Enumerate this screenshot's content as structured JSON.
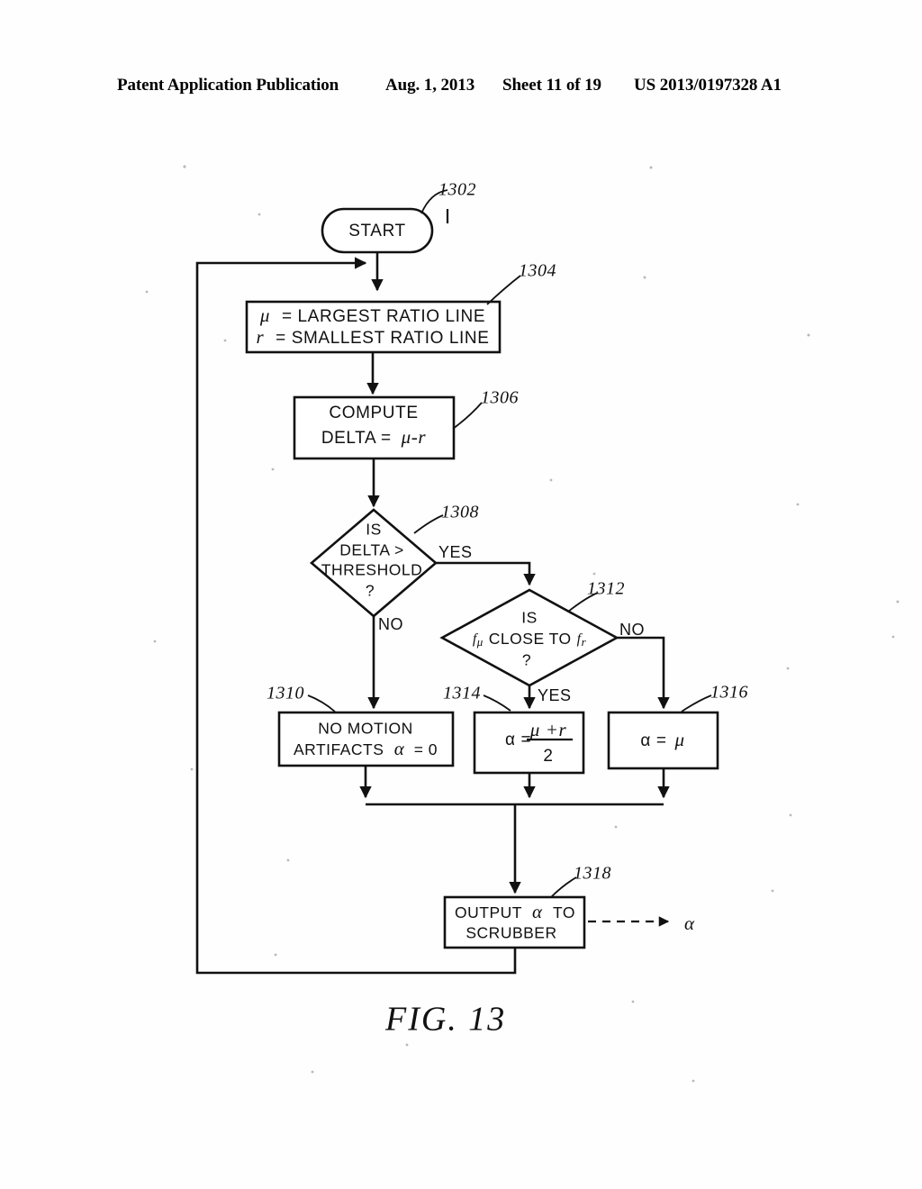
{
  "header": {
    "publication": "Patent Application Publication",
    "date": "Aug. 1, 2013",
    "sheet": "Sheet 11 of 19",
    "patent_number": "US 2013/0197328 A1"
  },
  "figure": {
    "caption": "FIG. 13",
    "output_symbol": "α"
  },
  "nodes": {
    "start": {
      "ref": "1302",
      "label": "START"
    },
    "define": {
      "ref": "1304",
      "line1_var": "μ",
      "line1": "= LARGEST RATIO LINE",
      "line2_var": "r",
      "line2": "= SMALLEST RATIO LINE"
    },
    "compute": {
      "ref": "1306",
      "line1": "COMPUTE",
      "line2": "DELTA =",
      "line2_expr": "μ-r"
    },
    "decision1": {
      "ref": "1308",
      "line1": "IS",
      "line2": "DELTA >",
      "line3": "THRESHOLD",
      "line4": "?"
    },
    "decision2": {
      "ref": "1312",
      "line1": "IS",
      "left_var": "f",
      "left_sub": "μ",
      "mid": "CLOSE TO",
      "right_var": "f",
      "right_sub": "r",
      "line3": "?"
    },
    "no_motion": {
      "ref": "1310",
      "line1": "NO MOTION",
      "line2": "ARTIFACTS",
      "line2_var": "α",
      "line2_val": "= 0"
    },
    "average": {
      "ref": "1314",
      "lhs": "α =",
      "numerator": "μ +r",
      "denominator": "2"
    },
    "assign_mu": {
      "ref": "1316",
      "expr_lhs": "α =",
      "expr_rhs": "μ"
    },
    "output": {
      "ref": "1318",
      "line1": "OUTPUT",
      "line1_var": "α",
      "line1_tail": "TO",
      "line2": "SCRUBBER"
    }
  },
  "branches": {
    "d1_yes": "YES",
    "d1_no": "NO",
    "d2_yes": "YES",
    "d2_no": "NO"
  }
}
